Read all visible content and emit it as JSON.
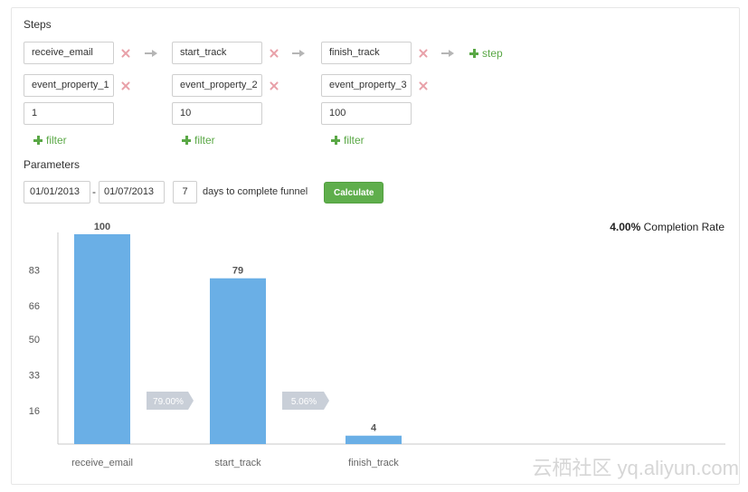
{
  "steps_section": {
    "title": "Steps",
    "steps": [
      {
        "event": "receive_email",
        "property": "event_property_1",
        "value": "1"
      },
      {
        "event": "start_track",
        "property": "event_property_2",
        "value": "10"
      },
      {
        "event": "finish_track",
        "property": "event_property_3",
        "value": "100"
      }
    ],
    "add_step_label": "step",
    "add_filter_label": "filter"
  },
  "parameters": {
    "title": "Parameters",
    "start_date": "01/01/2013",
    "dash": "-",
    "end_date": "01/07/2013",
    "days": "7",
    "days_label": "days to complete funnel",
    "calculate_label": "Calculate"
  },
  "completion": {
    "rate": "4.00%",
    "label": "Completion Rate"
  },
  "colors": {
    "bar": "#6aafe6",
    "accent_green": "#5aa846",
    "remove_red": "#e8a0a8",
    "conversion_tag": "#c9cfd8"
  },
  "chart_data": {
    "type": "bar",
    "categories": [
      "receive_email",
      "start_track",
      "finish_track"
    ],
    "values": [
      100,
      79,
      4
    ],
    "value_labels": [
      "100",
      "79",
      "4"
    ],
    "conversion_labels": [
      "79.00%",
      "5.06%"
    ],
    "yticks": [
      16,
      33,
      50,
      66,
      83
    ],
    "ytick_labels": [
      "16",
      "33",
      "50",
      "66",
      "83"
    ],
    "ylim": [
      0,
      100
    ],
    "grid": false
  },
  "watermark": "云栖社区 yq.aliyun.com"
}
